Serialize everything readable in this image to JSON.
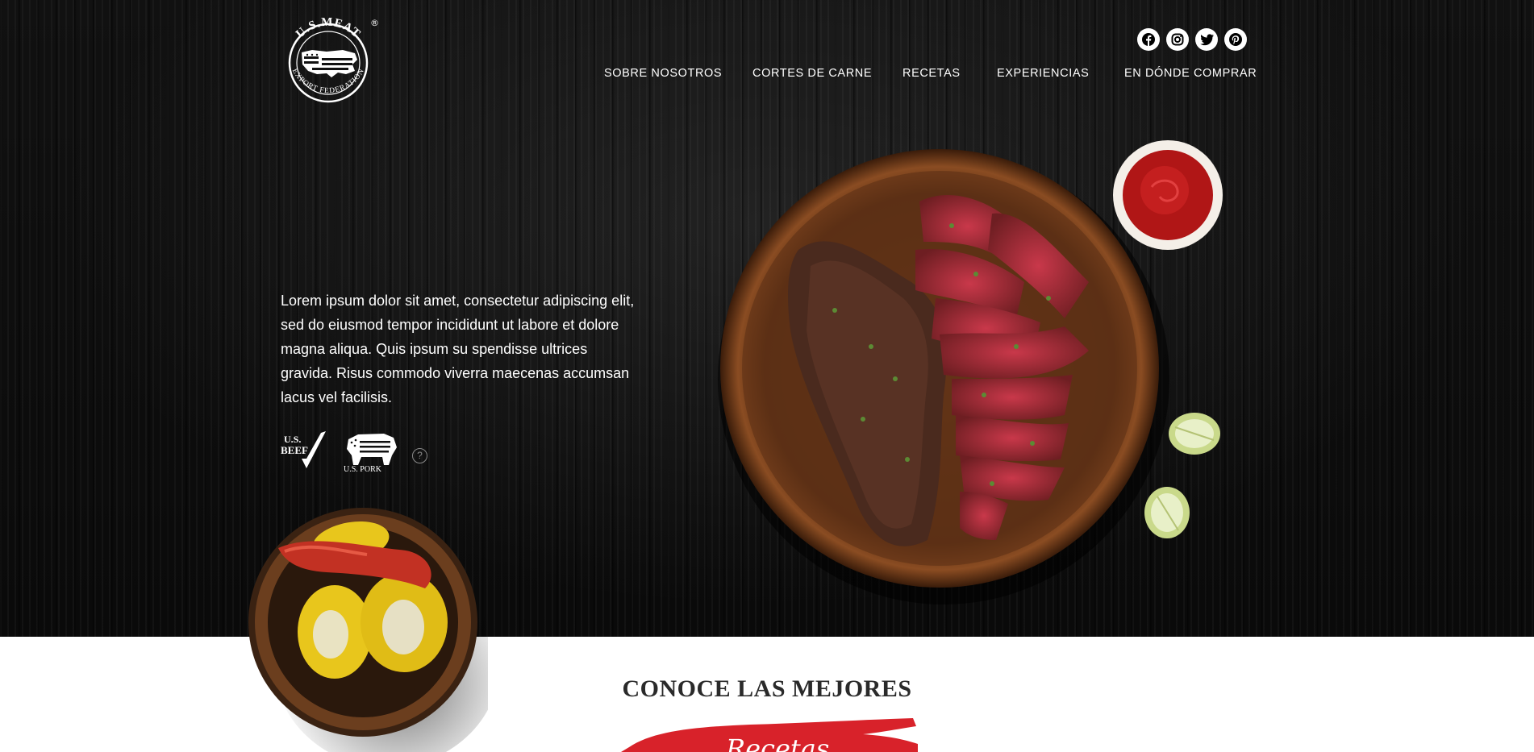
{
  "brand": {
    "logo_top_text": "U.S.MEAT",
    "logo_bottom_text": "EXPORT FEDERATION",
    "logo_mark": "®"
  },
  "social": [
    {
      "name": "facebook",
      "icon": "facebook-icon"
    },
    {
      "name": "instagram",
      "icon": "instagram-icon"
    },
    {
      "name": "twitter",
      "icon": "twitter-icon"
    },
    {
      "name": "pinterest",
      "icon": "pinterest-icon"
    }
  ],
  "nav": {
    "items": [
      {
        "label": "SOBRE NOSOTROS"
      },
      {
        "label": "CORTES DE CARNE"
      },
      {
        "label": "RECETAS"
      },
      {
        "label": "EXPERIENCIAS"
      },
      {
        "label": "EN DÓNDE COMPRAR"
      }
    ]
  },
  "hero": {
    "description": "Lorem ipsum dolor sit amet, consectetur adipiscing elit, sed do eiusmod tempor incididunt ut labore et dolore magna aliqua. Quis ipsum su spendisse ultrices gravida. Risus commodo viverra maecenas accumsan lacus vel facilisis."
  },
  "badges": {
    "beef_top": "U.S.",
    "beef_bottom": "BEEF",
    "pork_label": "U.S. PORK",
    "help_symbol": "?"
  },
  "section": {
    "title": "CONOCE LAS MEJORES",
    "brush_text": "Recetas"
  },
  "colors": {
    "hero_bg": "#0b0b0b",
    "accent_red": "#d8222a",
    "nav_text": "#ffffff",
    "section_title": "#2a2a2a"
  }
}
